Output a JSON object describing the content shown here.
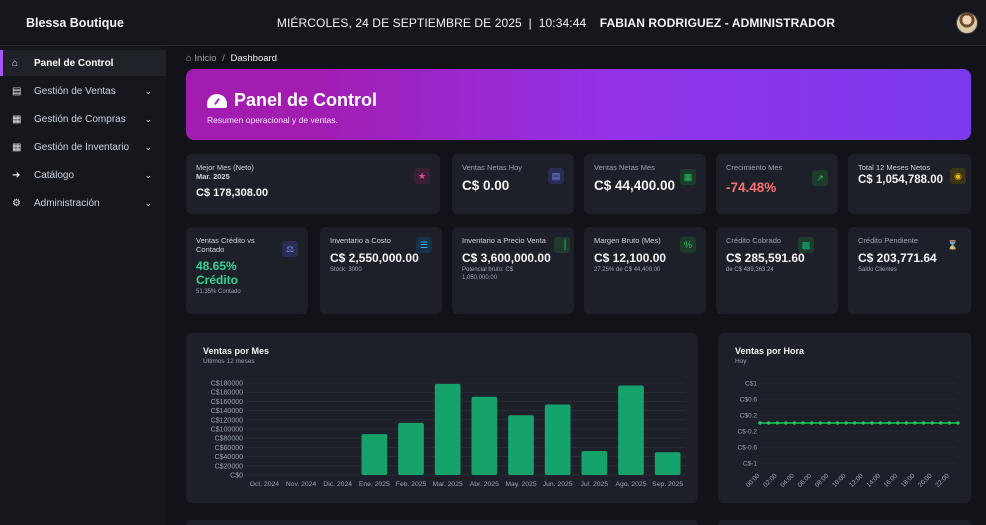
{
  "app": {
    "brand": "Blessa Boutique"
  },
  "topbar": {
    "datetime": "MIÉRCOLES, 24 DE SEPTIEMBRE DE 2025  |  10:34:44",
    "user": "FABIAN RODRIGUEZ - ADMINISTRADOR"
  },
  "sidebar": {
    "items": [
      {
        "label": "Panel de Control",
        "icon": "home-icon"
      },
      {
        "label": "Gestión de Ventas",
        "icon": "store-icon"
      },
      {
        "label": "Gestión de Compras",
        "icon": "boxes-icon"
      },
      {
        "label": "Gestión de Inventario",
        "icon": "warehouse-icon"
      },
      {
        "label": "Catálogo",
        "icon": "sign-in-icon"
      },
      {
        "label": "Administración",
        "icon": "gears-icon"
      }
    ]
  },
  "breadcrumb": {
    "home": "Inicio",
    "sep": "/",
    "current": "Dashboard"
  },
  "hero": {
    "title": "Panel de Control",
    "subtitle": "Resumen operacional y de ventas."
  },
  "kpis_row1": [
    {
      "label": "Mejor Mes (Neto)",
      "label2": "Mar. 2025",
      "value": "C$ 178,308.00",
      "icon": "trophy-icon",
      "color": "#ec4899"
    },
    {
      "label": "Ventas Netas Hoy",
      "value": "C$ 0.00",
      "icon": "store-icon",
      "color": "#6366f1"
    },
    {
      "label": "Ventas Netas Mes",
      "value": "C$ 44,400.00",
      "icon": "calendar-icon",
      "color": "#22c55e"
    },
    {
      "label": "Crecimiento Mes",
      "value": "-74.48%",
      "icon": "trend-icon",
      "color": "#f87171"
    },
    {
      "label": "Total 12 Meses Netos",
      "value": "C$ 1,054,788.00",
      "icon": "coins-icon",
      "color": "#eab308"
    }
  ],
  "kpis_row2": [
    {
      "label": "Ventas Crédito vs Contado",
      "value": "48.65%",
      "value2": "Crédito",
      "sub": "51.35% Contado",
      "icon": "scale-icon",
      "color": "#6366f1"
    },
    {
      "label": "Inventario a Costo",
      "value": "C$ 2,550,000.00",
      "sub": "Stock: 3000",
      "icon": "layers-icon",
      "color": "#0ea5e9"
    },
    {
      "label": "Inventario a Precio Venta",
      "value": "C$ 3,600,000.00",
      "sub": "Potencial bruto: C$ 1,050,000.00",
      "icon": "chart-icon",
      "color": "#22c55e"
    },
    {
      "label": "Margen Bruto (Mes)",
      "value": "C$ 12,100.00",
      "sub": "27.25% de C$ 44,400.00",
      "icon": "percent-icon",
      "color": "#22c55e"
    },
    {
      "label": "Crédito Cobrado",
      "value": "C$ 285,591.60",
      "sub": "de C$ 489,363.24",
      "icon": "cash-icon",
      "color": "#10b981"
    },
    {
      "label": "Crédito Pendiente",
      "value": "C$ 203,771.64",
      "sub": "Saldo Clientes",
      "icon": "hourglass-icon",
      "color": "#ef4444"
    }
  ],
  "chart_data": [
    {
      "type": "bar",
      "title": "Ventas por Mes",
      "subtitle": "Últimos 12 meses",
      "categories": [
        "Oct. 2024",
        "Nov. 2024",
        "Dic. 2024",
        "Ene. 2025",
        "Feb. 2025",
        "Mar. 2025",
        "Abr. 2025",
        "May. 2025",
        "Jun. 2025",
        "Jul. 2025",
        "Ago. 2025",
        "Sep. 2025"
      ],
      "values": [
        0,
        0,
        0,
        80000,
        102000,
        178308,
        153000,
        117000,
        138000,
        47000,
        175000,
        44400
      ],
      "yticks": [
        "C$0",
        "C$20000",
        "C$40000",
        "C$60000",
        "C$80000",
        "C$100000",
        "C$120000",
        "C$140000",
        "C$160000",
        "C$180000",
        "C$180000"
      ],
      "ylim": [
        0,
        180000
      ],
      "bar_color": "#16a36b",
      "grid": true
    },
    {
      "type": "line",
      "title": "Ventas por Hora",
      "subtitle": "Hoy",
      "x": [
        "00:00",
        "01:00",
        "02:00",
        "03:00",
        "04:00",
        "05:00",
        "06:00",
        "07:00",
        "08:00",
        "09:00",
        "10:00",
        "11:00",
        "12:00",
        "13:00",
        "14:00",
        "15:00",
        "16:00",
        "17:00",
        "18:00",
        "19:00",
        "20:00",
        "21:00",
        "22:00",
        "23:00"
      ],
      "xticks": [
        "00:00",
        "02:00",
        "04:00",
        "06:00",
        "08:00",
        "10:00",
        "12:00",
        "14:00",
        "16:00",
        "18:00",
        "20:00",
        "22:00"
      ],
      "values": [
        0,
        0,
        0,
        0,
        0,
        0,
        0,
        0,
        0,
        0,
        0,
        0,
        0,
        0,
        0,
        0,
        0,
        0,
        0,
        0,
        0,
        0,
        0,
        0
      ],
      "yticks": [
        "C$1",
        "C$0.6",
        "C$0.2",
        "C$-0.2",
        "C$-0.6",
        "C$-1"
      ],
      "ylim": [
        -1,
        1
      ],
      "line_color": "#22c55e",
      "grid": true
    }
  ]
}
